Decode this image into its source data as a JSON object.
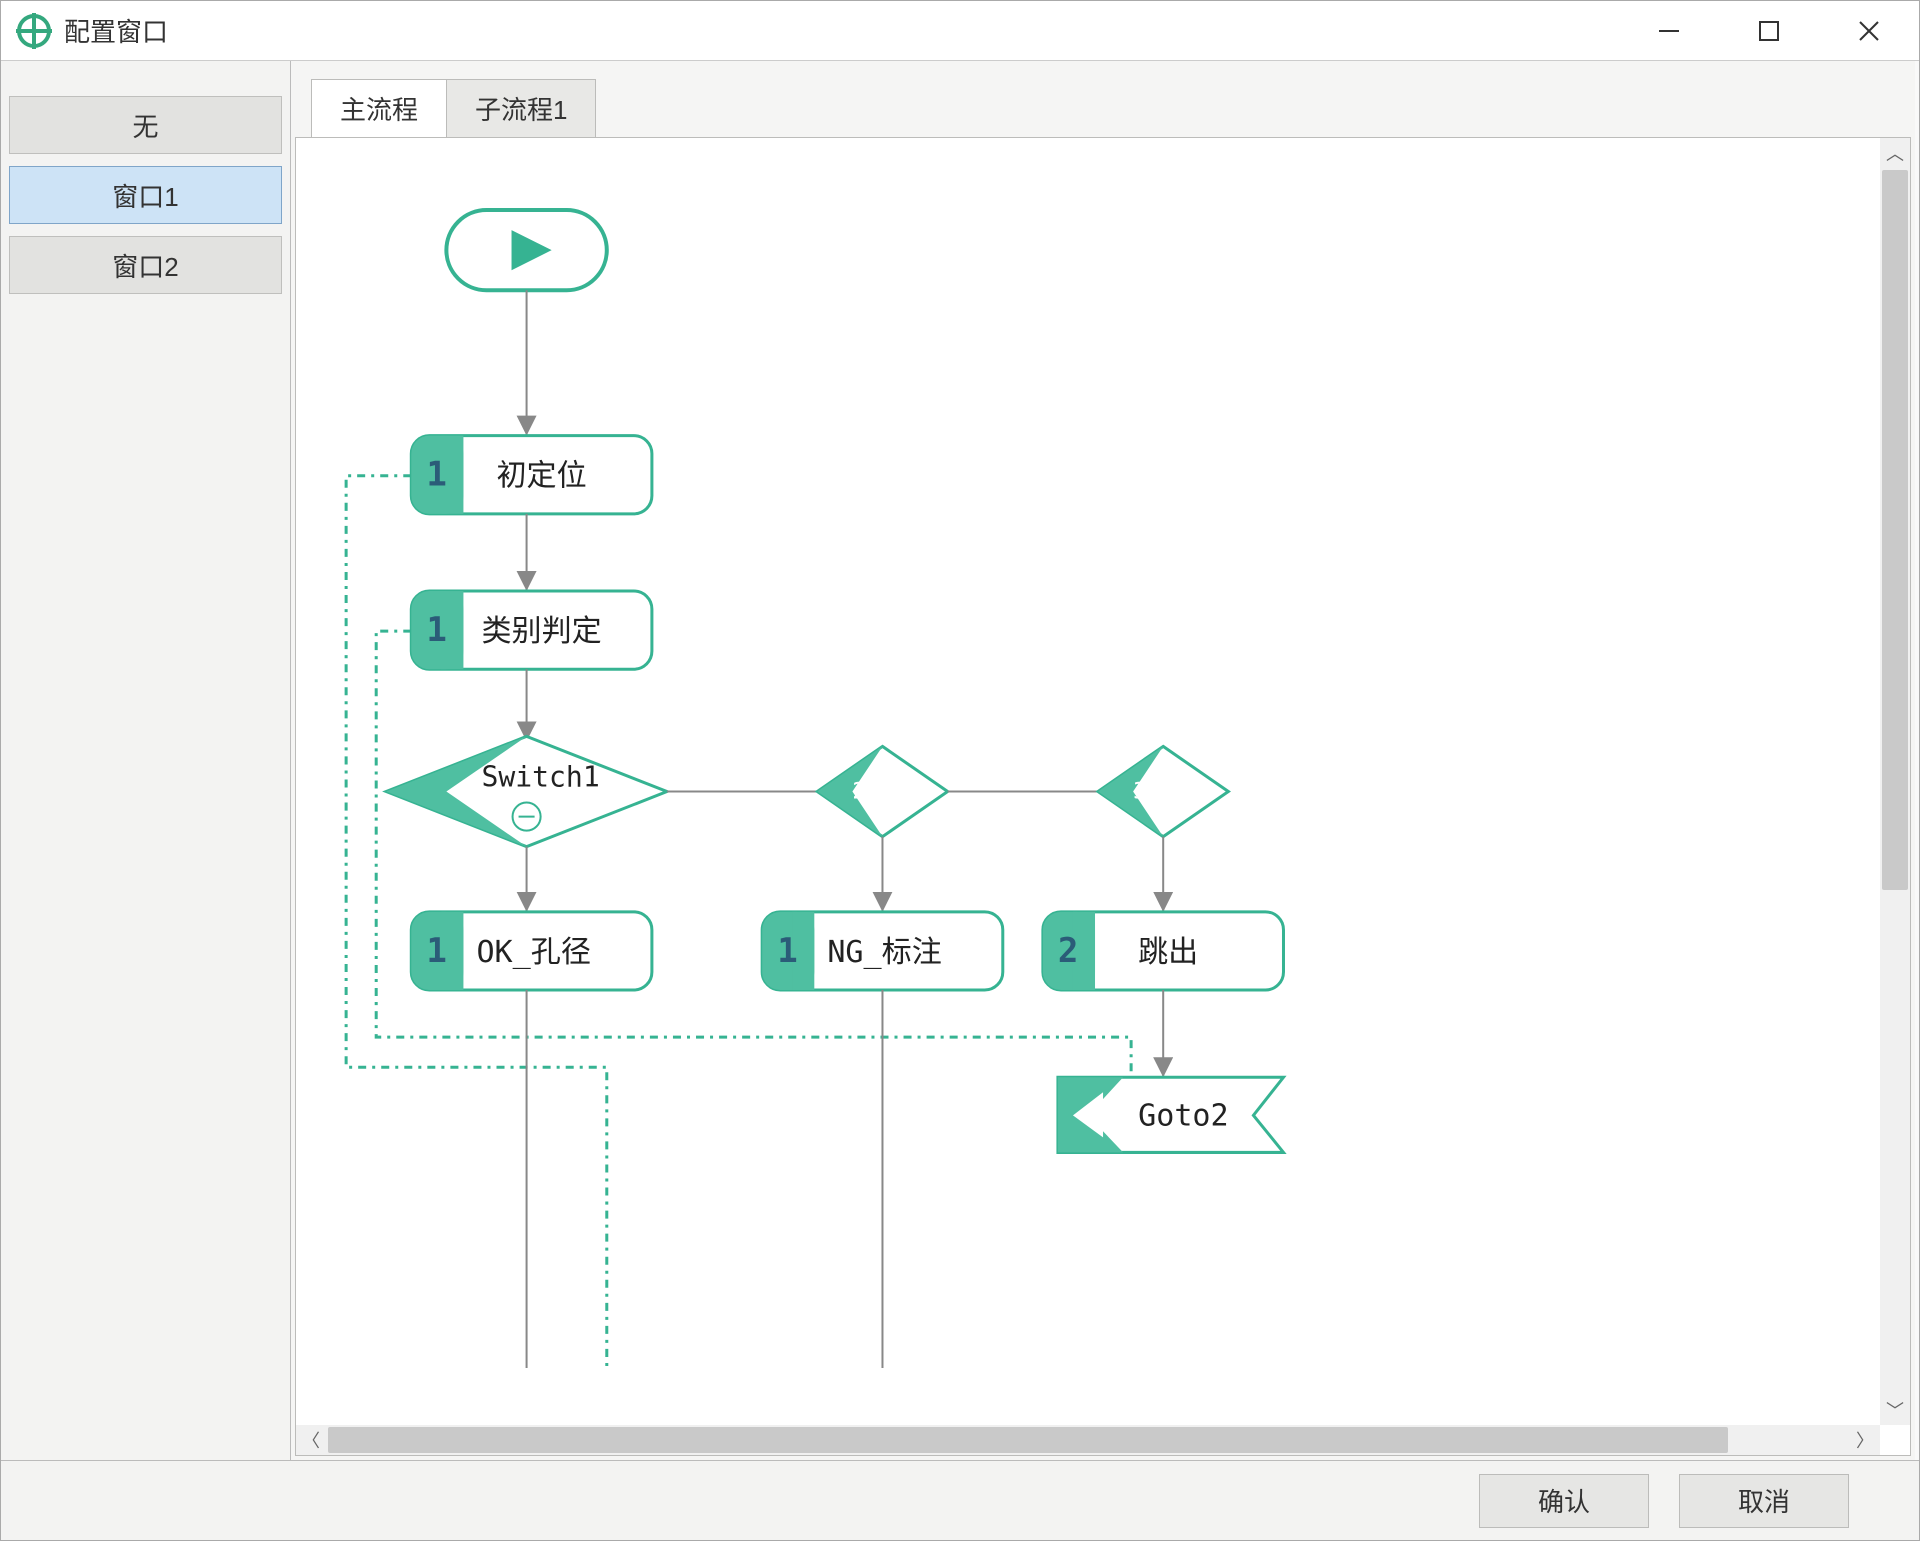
{
  "window": {
    "title": "配置窗口"
  },
  "sidebar": {
    "items": [
      {
        "label": "无"
      },
      {
        "label": "窗口1"
      },
      {
        "label": "窗口2"
      }
    ]
  },
  "tabs": [
    {
      "label": "主流程"
    },
    {
      "label": "子流程1"
    }
  ],
  "flow": {
    "node_init": {
      "badge": "1",
      "label": "初定位"
    },
    "node_class": {
      "badge": "1",
      "label": "类别判定"
    },
    "switch": {
      "label": "Switch1"
    },
    "diamond2": "2",
    "diamond3": "3",
    "node_ok": {
      "badge": "1",
      "label": "OK_孔径"
    },
    "node_ng": {
      "badge": "1",
      "label": "NG_标注"
    },
    "node_jump": {
      "badge": "2",
      "label": "跳出"
    },
    "goto": {
      "label": "Goto2"
    }
  },
  "footer": {
    "ok": "确认",
    "cancel": "取消"
  }
}
